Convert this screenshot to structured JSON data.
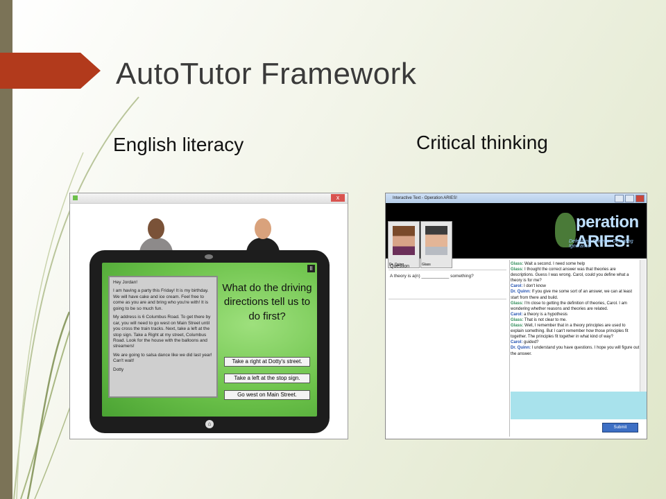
{
  "slide": {
    "title": "AutoTutor Framework",
    "left_caption": "English literacy",
    "right_caption": "Critical thinking",
    "accent_color": "#b23a1c"
  },
  "english_app": {
    "close_label": "x",
    "pause_label": "II",
    "home_icon": "home-icon",
    "letter": [
      "Hey Jordan!",
      "I am having a party this Friday! It is my birthday. We will have cake and ice cream. Feel free to come as you are and bring who you're with! It is going to be so much fun.",
      "My address is 6 Columbus Road. To get there by car, you will need to go west on Main Street until you cross the train tracks. Next, take a left at the stop sign. Take a Right at my street, Columbus Road. Look for the house with the balloons and streamers!",
      "We are going to salsa dance like we did last year! Can't wait!",
      "Dotty"
    ],
    "question": "What do the driving directions tell us to do first?",
    "options": [
      "Take a right at Dotty's street.",
      "Take a left at the stop sign.",
      "Go west on Main Street."
    ]
  },
  "aries_app": {
    "window_title": "Interactive Text - Operation ARIES!",
    "agents": [
      "Dr. Quinn",
      "Glass"
    ],
    "logo_text": "peration ARIES!",
    "logo_tagline": "Defending Science: Defeating Ignorance",
    "question_header": "Question",
    "question_text": "A theory is a(n) ___________ something?",
    "chat": [
      {
        "speaker": "Glass:",
        "text": " Wait a second. I need some help"
      },
      {
        "speaker": "Glass:",
        "text": " I thought the correct answer was that theories are descriptions. Guess I was wrong. Carol, could you define what a theory is for me?"
      },
      {
        "speaker": "Carol:",
        "text": " I don't know"
      },
      {
        "speaker": "Dr. Quinn:",
        "text": " If you give me some sort of an answer, we can at least start from there and build."
      },
      {
        "speaker": "Glass:",
        "text": " I'm close to getting the definition of theories, Carol. I am wondering whether reasons and theories are related."
      },
      {
        "speaker": "Carol:",
        "text": " a theory is a hypothesis"
      },
      {
        "speaker": "Glass:",
        "text": " That is not clear to me."
      },
      {
        "speaker": "Glass:",
        "text": " Well, I remember that in a theory principles are used to explain something. But I can't remember how those principles fit together. The principles fit together in what kind of way?"
      },
      {
        "speaker": "Carol:",
        "text": " guided?"
      },
      {
        "speaker": "Dr. Quinn:",
        "text": " I understand you have questions. I hope you will figure out the answer."
      }
    ],
    "submit_label": "Submit"
  }
}
